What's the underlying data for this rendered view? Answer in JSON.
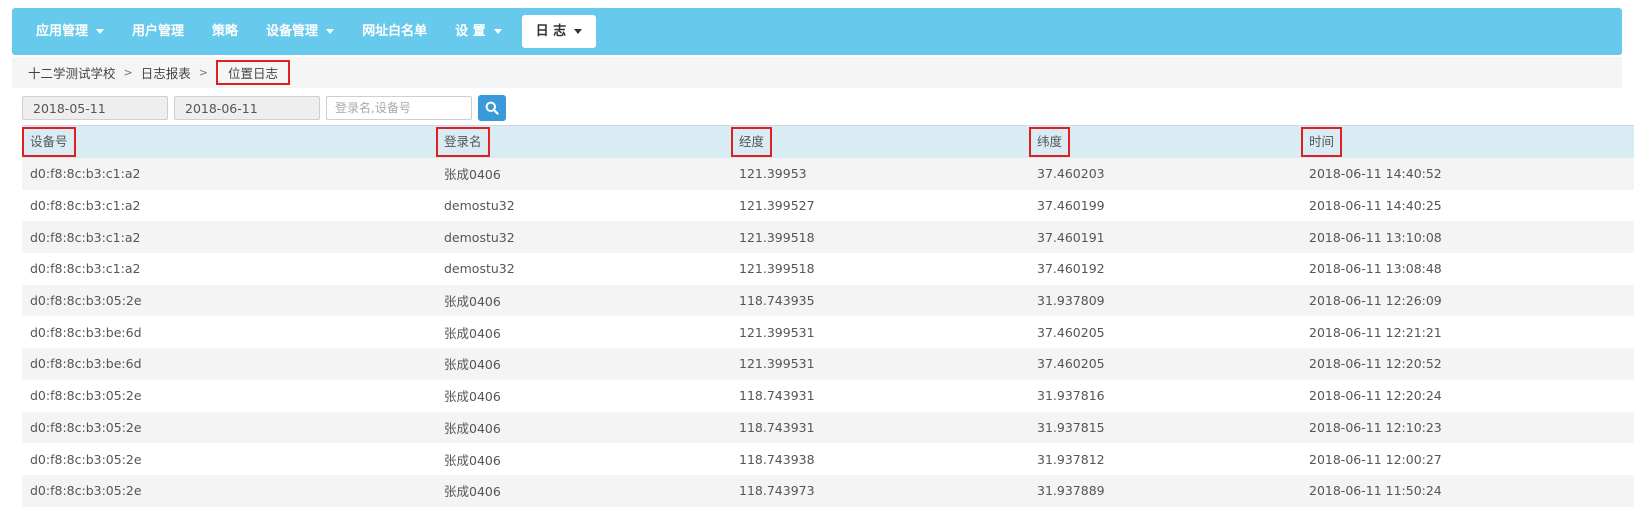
{
  "nav": {
    "items": [
      {
        "label": "应用管理",
        "dropdown": true
      },
      {
        "label": "用户管理",
        "dropdown": false
      },
      {
        "label": "策略",
        "dropdown": false
      },
      {
        "label": "设备管理",
        "dropdown": true
      },
      {
        "label": "网址白名单",
        "dropdown": false
      },
      {
        "label": "设 置",
        "dropdown": true
      }
    ],
    "active": {
      "label": "日 志",
      "dropdown": true
    }
  },
  "breadcrumb": {
    "school": "十二学测试学校",
    "sep": ">",
    "report": "日志报表",
    "current": "位置日志"
  },
  "filter": {
    "start_date": "2018-05-11",
    "end_date": "2018-06-11",
    "search_placeholder": "登录名,设备号"
  },
  "table": {
    "headers": [
      "设备号",
      "登录名",
      "经度",
      "纬度",
      "时间"
    ],
    "rows": [
      [
        "d0:f8:8c:b3:c1:a2",
        "张成0406",
        "121.39953",
        "37.460203",
        "2018-06-11 14:40:52"
      ],
      [
        "d0:f8:8c:b3:c1:a2",
        "demostu32",
        "121.399527",
        "37.460199",
        "2018-06-11 14:40:25"
      ],
      [
        "d0:f8:8c:b3:c1:a2",
        "demostu32",
        "121.399518",
        "37.460191",
        "2018-06-11 13:10:08"
      ],
      [
        "d0:f8:8c:b3:c1:a2",
        "demostu32",
        "121.399518",
        "37.460192",
        "2018-06-11 13:08:48"
      ],
      [
        "d0:f8:8c:b3:05:2e",
        "张成0406",
        "118.743935",
        "31.937809",
        "2018-06-11 12:26:09"
      ],
      [
        "d0:f8:8c:b3:be:6d",
        "张成0406",
        "121.399531",
        "37.460205",
        "2018-06-11 12:21:21"
      ],
      [
        "d0:f8:8c:b3:be:6d",
        "张成0406",
        "121.399531",
        "37.460205",
        "2018-06-11 12:20:52"
      ],
      [
        "d0:f8:8c:b3:05:2e",
        "张成0406",
        "118.743931",
        "31.937816",
        "2018-06-11 12:20:24"
      ],
      [
        "d0:f8:8c:b3:05:2e",
        "张成0406",
        "118.743931",
        "31.937815",
        "2018-06-11 12:10:23"
      ],
      [
        "d0:f8:8c:b3:05:2e",
        "张成0406",
        "118.743938",
        "31.937812",
        "2018-06-11 12:00:27"
      ],
      [
        "d0:f8:8c:b3:05:2e",
        "张成0406",
        "118.743973",
        "31.937889",
        "2018-06-11 11:50:24"
      ]
    ]
  },
  "colors": {
    "nav_bg": "#67c9ec",
    "header_bg": "#d9ecf4",
    "highlight": "#e02020",
    "search_button": "#3a9ad9"
  },
  "icons": {
    "search": "search-icon",
    "dropdown": "caret-down-icon"
  }
}
